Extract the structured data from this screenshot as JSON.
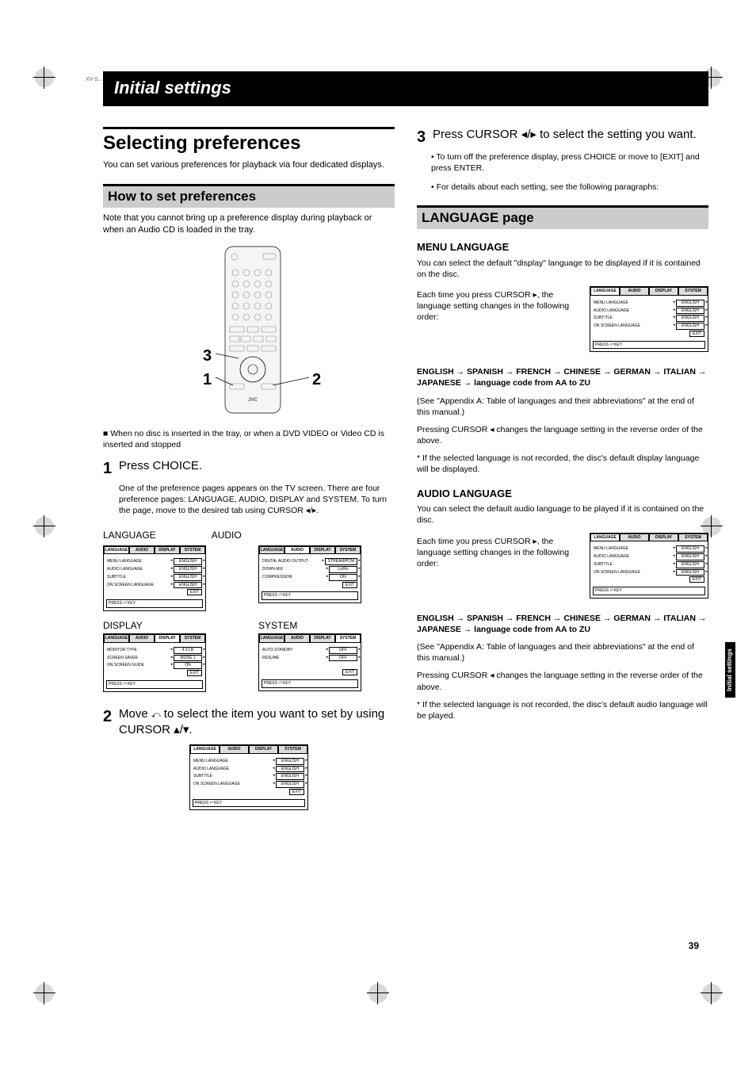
{
  "header": {
    "title": "Initial settings"
  },
  "sidebar": {
    "label": "Initial settings"
  },
  "page_number": "39",
  "model_ref": "XV-S...",
  "left": {
    "h1": "Selecting preferences",
    "intro": "You can set various preferences for playback via four dedicated displays.",
    "sub1": "How to set preferences",
    "sub1_body": "Note that you cannot bring up a preference display during playback or when an Audio CD is loaded in the tray.",
    "remote_labels": {
      "one": "1",
      "two": "2",
      "three": "3"
    },
    "note_square": "When no disc is inserted in the tray, or when a DVD VIDEO or Video CD is inserted and stopped",
    "step1_num": "1",
    "step1_text": "Press CHOICE.",
    "step1_body": "One of the preference pages appears on the TV screen. There are four preference pages: LANGUAGE, AUDIO, DISPLAY and SYSTEM. To turn the page, move       to the desired tab using CURSOR ◂/▸.",
    "caps": {
      "language": "LANGUAGE",
      "audio": "AUDIO",
      "display": "DISPLAY",
      "system": "SYSTEM"
    },
    "step2_num": "2",
    "step2_text_a": "Move ",
    "step2_text_b": " to select the item you want to set by using CURSOR ▴/▾."
  },
  "right": {
    "step3_num": "3",
    "step3_text": "Press CURSOR ◂/▸ to select the setting you want.",
    "step3_b1": "To turn off the preference display, press CHOICE or move       to [EXIT] and press ENTER.",
    "step3_b2": "For details about each setting, see the following paragraphs:",
    "sub2": "LANGUAGE page",
    "menu_lang_h": "MENU LANGUAGE",
    "menu_lang_p1": "You can select the default \"display\" language to be displayed if it is contained on the disc.",
    "menu_lang_p2": "Each time you press CURSOR ▸, the language setting changes in the following order:",
    "seq": "ENGLISH → SPANISH → FRENCH → CHINESE → GERMAN → ITALIAN → JAPANESE → language code from AA to ZU",
    "seq_note": "(See \"Appendix A: Table of languages and their abbreviations\" at the end of this manual.)",
    "reverse": "Pressing CURSOR ◂ changes the language setting in the reverse order of the above.",
    "menu_foot": "*  If the selected language is not recorded, the disc's default display language will be displayed.",
    "audio_lang_h": "AUDIO LANGUAGE",
    "audio_lang_p1": "You can select the default audio language to be played if it is contained on the disc.",
    "audio_lang_p2": "Each time you press CURSOR ▸, the language setting changes in the following order:",
    "audio_foot": "*  If the selected language is not recorded, the disc's default audio language will be played."
  },
  "screens": {
    "tabs": [
      "LANGUAGE",
      "AUDIO",
      "DISPLAY",
      "SYSTEM"
    ],
    "exit": "EXIT",
    "press_key": "PRESS  ⏎  KEY",
    "language_rows": [
      {
        "label": "MENU LANGUAGE",
        "val": "ENGLISH"
      },
      {
        "label": "AUDIO LANGUAGE",
        "val": "ENGLISH"
      },
      {
        "label": "SUBTITLE",
        "val": "ENGLISH"
      },
      {
        "label": "ON SCREEN LANGUAGE",
        "val": "ENGLISH"
      }
    ],
    "audio_rows": [
      {
        "label": "DIGITAL AUDIO OUTPUT",
        "val": "STREAM/PCM"
      },
      {
        "label": "DOWN MIX",
        "val": "Lo/Ro"
      },
      {
        "label": "COMPRESSION",
        "val": "ON"
      }
    ],
    "display_rows": [
      {
        "label": "MONITOR TYPE",
        "val": "4:3 LB"
      },
      {
        "label": "SCREEN SAVER",
        "val": "MODE 1"
      },
      {
        "label": "ON SCREEN GUIDE",
        "val": "ON"
      }
    ],
    "system_rows": [
      {
        "label": "AUTO STANDBY",
        "val": "OFF"
      },
      {
        "label": "RESUME",
        "val": "OFF"
      }
    ]
  }
}
